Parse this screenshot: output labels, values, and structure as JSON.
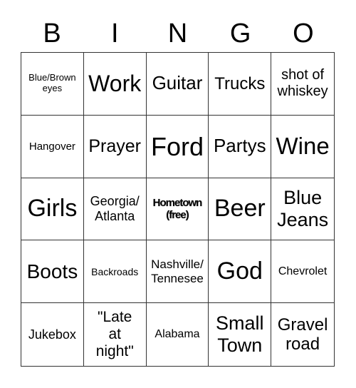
{
  "header": [
    "B",
    "I",
    "N",
    "G",
    "O"
  ],
  "cells": [
    "Blue/Brown eyes",
    "Work",
    "Guitar",
    "Trucks",
    "shot of whiskey",
    "Hangover",
    "Prayer",
    "Ford",
    "Partys",
    "Wine",
    "Girls",
    "Georgia/ Atlanta",
    "Hometown (free)",
    "Beer",
    "Blue Jeans",
    "Boots",
    "Backroads",
    "Nashville/ Tennesee",
    "God",
    "Chevrolet",
    "Jukebox",
    "\"Late at night\"",
    "Alabama",
    "Small Town",
    "Gravel road"
  ]
}
